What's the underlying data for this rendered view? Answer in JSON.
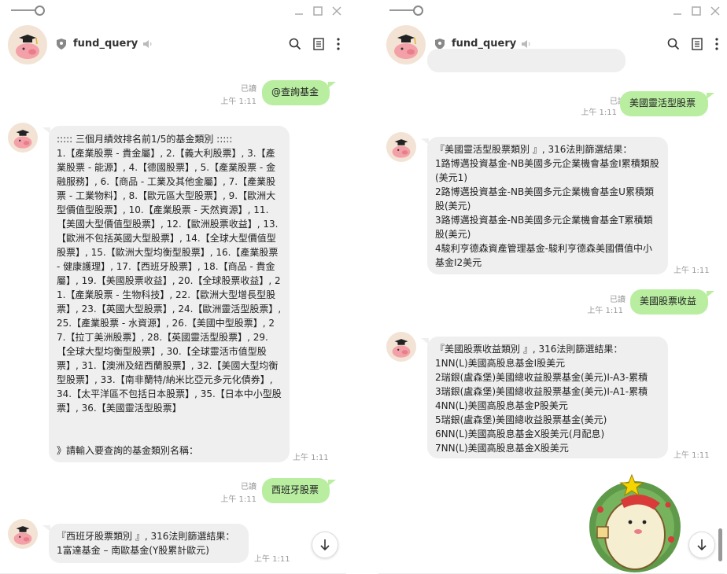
{
  "left": {
    "header": {
      "chat_name": "fund_query"
    },
    "messages": {
      "m1": {
        "text": "@查詢基金",
        "read": "已讀",
        "time": "上午 1:11"
      },
      "m2": {
        "text": "::::: 三個月績效排名前1/5的基金類別 :::::\n1.【產業股票 - 貴金屬】, 2.【義大利股票】, 3.【產業股票 - 能源】, 4.【德國股票】, 5.【產業股票 - 金融服務】, 6.【商品 - 工業及其他金屬】, 7.【產業股票 - 工業物料】, 8.【歐元區大型股票】, 9.【歐洲大型價值型股票】, 10.【產業股票 - 天然資源】, 11.【美國大型價值型股票】, 12.【歐洲股票收益】, 13.【歐洲不包括英國大型股票】, 14.【全球大型價值型股票】, 15.【歐洲大型均衡型股票】, 16.【產業股票 - 健康護理】, 17.【西班牙股票】, 18.【商品 - 貴金屬】, 19.【美國股票收益】, 20.【全球股票收益】, 21.【產業股票 - 生物科技】, 22.【歐洲大型增長型股票】, 23.【英國大型股票】, 24.【歐洲靈活型股票】, 25.【產業股票 - 水資源】, 26.【美國中型股票】, 27.【拉丁美洲股票】, 28.【英國靈活型股票】, 29.【全球大型均衡型股票】, 30.【全球靈活市值型股票】, 31.【澳洲及紐西蘭股票】, 32.【美國大型均衡型股票】, 33.【南非蘭特/納米比亞元多元化債券】, 34.【太平洋區不包括日本股票】, 35.【日本中小型股票】, 36.【美國靈活型股票】\n\n\n》請輸入要查詢的基金類別名稱：",
        "time": "上午 1:11"
      },
      "m3": {
        "text": "西班牙股票",
        "read": "已讀",
        "time": "上午 1:11"
      },
      "m4": {
        "text": "『西班牙股票類別 』, 316法則篩選結果：\n1富達基金 – 南歐基金(Y股累計歐元)",
        "time": "上午 1:11"
      }
    }
  },
  "right": {
    "header": {
      "chat_name": "fund_query"
    },
    "messages": {
      "m1": {
        "text": "美國靈活型股票",
        "read": "已讀",
        "time": "上午 1:11"
      },
      "m2": {
        "text": "『美國靈活型股票類別 』, 316法則篩選結果：\n1路博邁投資基金-NB美國多元企業機會基金I累積類股(美元1)\n2路博邁投資基金-NB美國多元企業機會基金U累積類股(美元)\n3路博邁投資基金-NB美國多元企業機會基金T累積類股(美元)\n4駿利亨德森資產管理基金-駿利亨德森美國價值中小基金I2美元",
        "time": "上午 1:11"
      },
      "m3": {
        "text": "美國股票收益",
        "read": "已讀",
        "time": "上午 1:11"
      },
      "m4": {
        "text": "『美國股票收益類別 』, 316法則篩選結果：\n1NN(L)美國高股息基金I股美元\n2瑞銀(盧森堡)美國總收益股票基金(美元)I-A3-累積\n3瑞銀(盧森堡)美國總收益股票基金(美元)I-A1-累積\n4NN(L)美國高股息基金P股美元\n5瑞銀(盧森堡)美國總收益股票基金(美元)\n6NN(L)美國高股息基金X股美元(月配息)\n7NN(L)美國高股息基金X股美元",
        "time": "上午 1:11"
      }
    }
  },
  "colors": {
    "my_bubble": "#b9eea1",
    "other_bubble": "#efefef",
    "meta_text": "#999999"
  },
  "icons": [
    "minimize-icon",
    "maximize-icon",
    "close-icon",
    "shield-icon",
    "speaker-muted-icon",
    "search-icon",
    "notes-icon",
    "more-icon",
    "arrow-down-icon",
    "sticker-hedgehog"
  ]
}
